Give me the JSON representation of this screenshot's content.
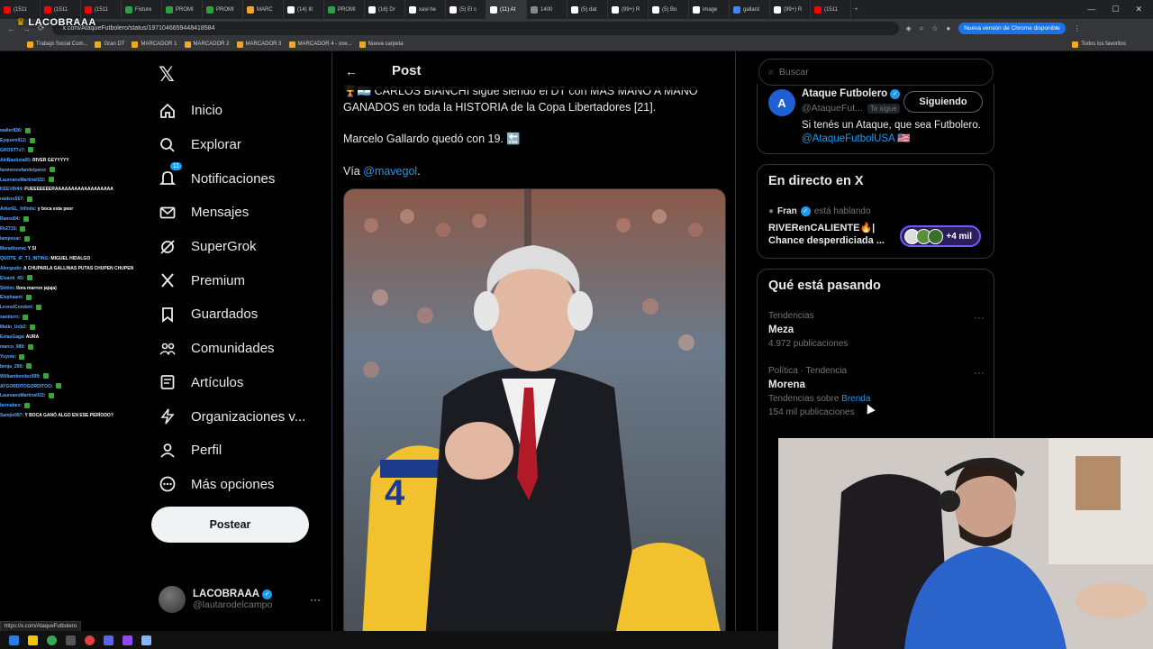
{
  "browser": {
    "tabs": [
      {
        "label": "(1511",
        "color": "#ff0000"
      },
      {
        "label": "(1511",
        "color": "#ff0000"
      },
      {
        "label": "(1511",
        "color": "#ff0000"
      },
      {
        "label": "Fixture",
        "color": "#2ea043"
      },
      {
        "label": "PROMI",
        "color": "#2ea043"
      },
      {
        "label": "PROMI",
        "color": "#2ea043"
      },
      {
        "label": "MARC",
        "color": "#f5a623"
      },
      {
        "label": "(14) Ilt",
        "color": "#ffffff"
      },
      {
        "label": "PROMI",
        "color": "#2ea043"
      },
      {
        "label": "(16) Dr",
        "color": "#ffffff"
      },
      {
        "label": "xavi he",
        "color": "#ffffff"
      },
      {
        "label": "(5) El c",
        "color": "#ffffff"
      },
      {
        "label": "(11) At",
        "color": "#ffffff"
      },
      {
        "label": "1400",
        "color": "#888888"
      },
      {
        "label": "(5) dat",
        "color": "#ffffff"
      },
      {
        "label": "(99+) R",
        "color": "#ffffff"
      },
      {
        "label": "(5) Bo",
        "color": "#ffffff"
      },
      {
        "label": "image",
        "color": "#ffffff"
      },
      {
        "label": "gallard",
        "color": "#4285f4"
      },
      {
        "label": "(99+) R",
        "color": "#ffffff"
      },
      {
        "label": "(1511",
        "color": "#ff0000"
      }
    ],
    "active_tab_index": 12,
    "url": "x.com/AtaqueFutbolero/status/1971046659448418584",
    "update_label": "Nueva versión de Chrome disponible",
    "bookmarks": [
      "Trabajo Social Com...",
      "Gran DT",
      "MARCADOR 1",
      "MARCADOR 2",
      "MARCADOR 3",
      "MARCADOR 4 - ove...",
      "Nueva carpeta"
    ],
    "bookmarks_right": "Todos los favoritos",
    "status_url": "https://x.com/AtaqueFutbolero"
  },
  "stream": {
    "logo": "LACOBRAAA"
  },
  "chat": [
    {
      "user": "walter826",
      "msg": ""
    },
    {
      "user": "Eyquem912",
      "msg": ""
    },
    {
      "user": "GHOST7x7",
      "msg": ""
    },
    {
      "user": "AleBautista05",
      "msg": "RIVER GEYYYYY"
    },
    {
      "user": "fanmenosfandelpavo",
      "msg": ""
    },
    {
      "user": "LaureanoMartinell22",
      "msg": ""
    },
    {
      "user": "KEEVIN44",
      "msg": "FUEEEEEEERAAAAAAAAAAAAAAAAAA"
    },
    {
      "user": "raiders567",
      "msg": ""
    },
    {
      "user": "ArkerEL_Infinite",
      "msg": "y boca esta peor"
    },
    {
      "user": "Ramsi04",
      "msg": ""
    },
    {
      "user": "Fb2715",
      "msg": ""
    },
    {
      "user": "lamjosue",
      "msg": ""
    },
    {
      "user": "Maradiosna",
      "msg": "Y SI"
    },
    {
      "user": "QUOTE_IF_T1_INTING",
      "msg": "MIGUEL HIDALGO"
    },
    {
      "user": "Alengudo",
      "msg": "A CHUPARLA GALLINAS PUTAS CHUPEN CHUPEN"
    },
    {
      "user": "Elsanti_45",
      "msg": ""
    },
    {
      "user": "Skhlm",
      "msg": "llora marron jajaja)"
    },
    {
      "user": "Elephaant",
      "msg": ""
    },
    {
      "user": "LeonelCondori",
      "msg": ""
    },
    {
      "user": "santierrr",
      "msg": ""
    },
    {
      "user": "Matin_Ucb2",
      "msg": ""
    },
    {
      "user": "EstasGaga",
      "msg": "AURA"
    },
    {
      "user": "marco_989",
      "msg": ""
    },
    {
      "user": "Yuyote",
      "msg": ""
    },
    {
      "user": "benja_200",
      "msg": ""
    },
    {
      "user": "Williambenitez999",
      "msg": ""
    },
    {
      "user": "AYGORDITOGORDITOO",
      "msg": ""
    },
    {
      "user": "LaureanoMartinell22",
      "msg": ""
    },
    {
      "user": "bernabex",
      "msg": ""
    },
    {
      "user": "Samjis997",
      "msg": "Y BOCA GANÓ ALGO EN ESE PERÍODO?"
    }
  ],
  "sidebar": {
    "items": [
      {
        "label": "Inicio",
        "icon": "home-icon"
      },
      {
        "label": "Explorar",
        "icon": "search-icon"
      },
      {
        "label": "Notificaciones",
        "icon": "bell-icon"
      },
      {
        "label": "Mensajes",
        "icon": "mail-icon"
      },
      {
        "label": "SuperGrok",
        "icon": "grok-icon"
      },
      {
        "label": "Premium",
        "icon": "x-premium-icon"
      },
      {
        "label": "Guardados",
        "icon": "bookmark-icon"
      },
      {
        "label": "Comunidades",
        "icon": "communities-icon"
      },
      {
        "label": "Artículos",
        "icon": "articles-icon"
      },
      {
        "label": "Organizaciones v...",
        "icon": "lightning-icon"
      },
      {
        "label": "Perfil",
        "icon": "person-icon"
      },
      {
        "label": "Más opciones",
        "icon": "more-circle-icon"
      }
    ],
    "notification_count": "11",
    "post_button": "Postear",
    "profile": {
      "name": "LACOBRAAA",
      "handle": "@lautarodelcampo"
    }
  },
  "main": {
    "header_title": "Post",
    "post_line1": "🏆🇦🇷 CARLOS BIANCHI sigue siendo el DT con MÁS MANO A MANO GANADOS en toda la HISTORIA de la Copa Libertadores [21].",
    "post_line2": "Marcelo Gallardo quedó con 19. 🔚",
    "via_prefix": "Vía ",
    "via_link": "@mavegol",
    "via_suffix": "."
  },
  "right": {
    "search_placeholder": "Buscar",
    "account": {
      "name": "Ataque Futbolero",
      "handle": "@AtaqueFut...",
      "follows_you": "Te sigue",
      "follow_state": "Siguiendo",
      "bio": "Si tenés un Ataque, que sea Futbolero.",
      "bio_link": "@AtaqueFutbolUSA 🇺🇸"
    },
    "live": {
      "title": "En directo en X",
      "host": "Fran",
      "host_suffix": "está hablando",
      "space_title": "RIVERenCALIENTE🔥| Chance desperdiciada ...",
      "listeners": "+4 mil"
    },
    "trends_title": "Qué está pasando",
    "trends": [
      {
        "meta": "Tendencias",
        "name": "Meza",
        "extra_prefix": "",
        "extra_link": "",
        "count": "4.972 publicaciones"
      },
      {
        "meta": "Política · Tendencia",
        "name": "Morena",
        "extra_prefix": "Tendencias sobre ",
        "extra_link": "Brenda",
        "count": "154 mil publicaciones"
      }
    ]
  },
  "colors": {
    "accent": "#1d9bf0",
    "background": "#000000",
    "text": "#e7e9ea",
    "muted": "#71767b",
    "border": "#2f3336"
  }
}
